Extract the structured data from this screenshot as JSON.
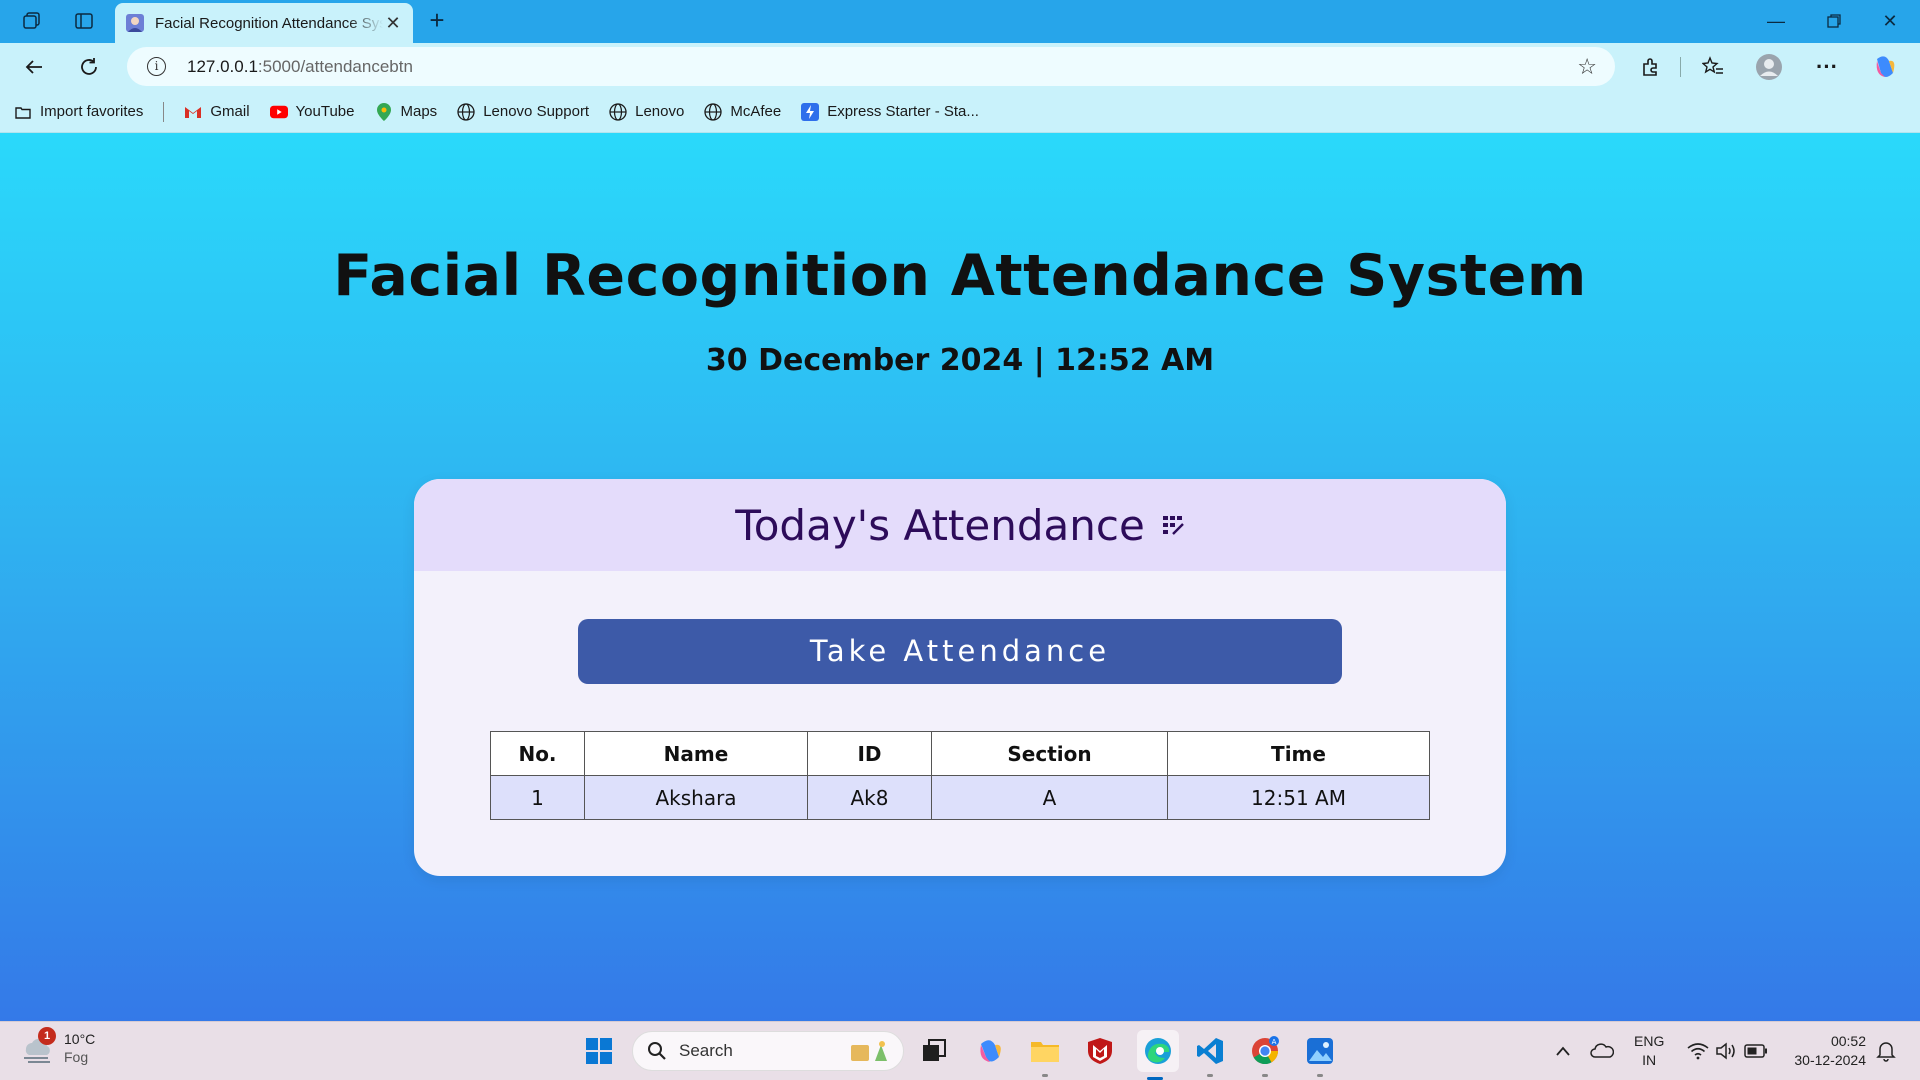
{
  "browser": {
    "tab_title": "Facial Recognition Attendance System",
    "url_host": "127.0.0.1",
    "url_path": ":5000/attendancebtn",
    "bookmarks": [
      "Import favorites",
      "Gmail",
      "YouTube",
      "Maps",
      "Lenovo Support",
      "Lenovo",
      "McAfee",
      "Express Starter - Sta..."
    ]
  },
  "page": {
    "title": "Facial Recognition Attendance System",
    "datetime": "30 December 2024 | 12:52 AM"
  },
  "card": {
    "title": "Today's Attendance",
    "button_label": "Take Attendance",
    "columns": [
      "No.",
      "Name",
      "ID",
      "Section",
      "Time"
    ],
    "rows": [
      {
        "no": "1",
        "name": "Akshara",
        "id": "Ak8",
        "section": "A",
        "time": "12:51 AM"
      }
    ]
  },
  "taskbar": {
    "weather_temp": "10°C",
    "weather_desc": "Fog",
    "weather_badge": "1",
    "search_label": "Search",
    "lang_line1": "ENG",
    "lang_line2": "IN",
    "time": "00:52",
    "date": "30-12-2024"
  },
  "colors": {
    "page_gradient_top": "#2ad9fb",
    "page_gradient_bottom": "#3479e8",
    "button": "#3d5aa8",
    "card_header": "#e4dcfb",
    "card_title_text": "#2d0c5a"
  }
}
